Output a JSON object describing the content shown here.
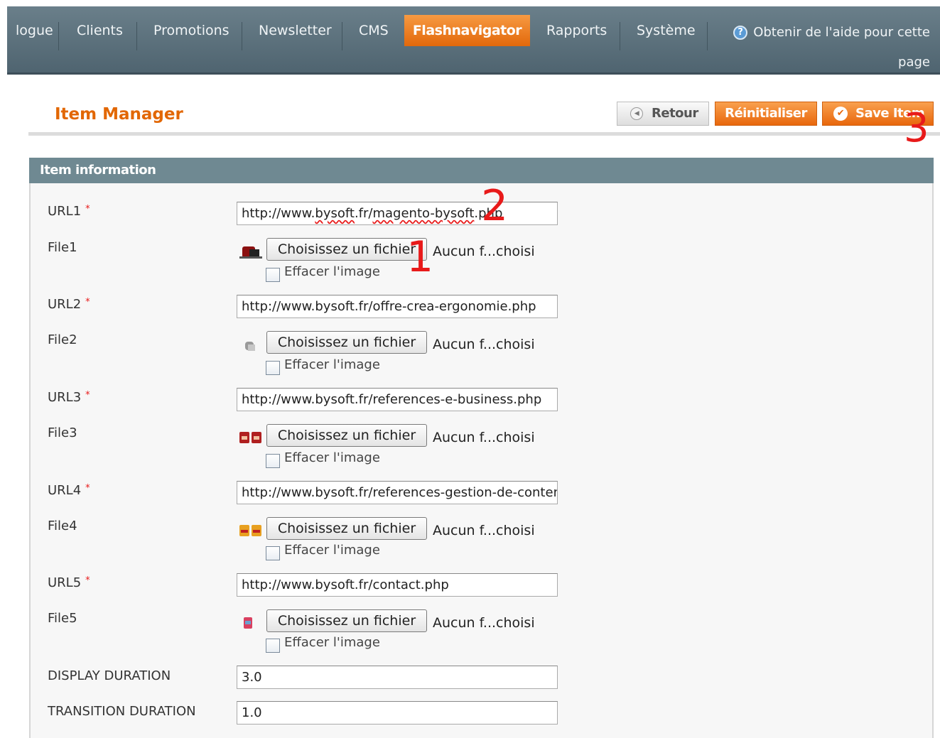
{
  "nav": {
    "items": [
      "logue",
      "Clients",
      "Promotions",
      "Newsletter",
      "CMS",
      "Flashnavigator",
      "Rapports",
      "Système"
    ],
    "help_text": "Obtenir de l'aide pour cette page"
  },
  "header": {
    "title": "Item Manager",
    "back_label": "Retour",
    "reset_label": "Réinitialiser",
    "save_label": "Save Item"
  },
  "annotations": [
    "1",
    "2",
    "3"
  ],
  "form": {
    "section_title": "Item information",
    "url1": {
      "label": "URL1",
      "required": "*",
      "value_plain": "http://www.",
      "value_under1": "bysoft",
      "value_mid": ".fr/",
      "value_under2": "magento-bysoft",
      "value_end": ".php"
    },
    "file1": {
      "label": "File1",
      "button": "Choisissez un fichier",
      "status": "Aucun f...choisi",
      "delete_label": "Effacer l'image"
    },
    "url2": {
      "label": "URL2",
      "required": "*",
      "value": "http://www.bysoft.fr/offre-crea-ergonomie.php"
    },
    "file2": {
      "label": "File2",
      "button": "Choisissez un fichier",
      "status": "Aucun f...choisi",
      "delete_label": "Effacer l'image"
    },
    "url3": {
      "label": "URL3",
      "required": "*",
      "value": "http://www.bysoft.fr/references-e-business.php"
    },
    "file3": {
      "label": "File3",
      "button": "Choisissez un fichier",
      "status": "Aucun f...choisi",
      "delete_label": "Effacer l'image"
    },
    "url4": {
      "label": "URL4",
      "required": "*",
      "value": "http://www.bysoft.fr/references-gestion-de-contenu"
    },
    "file4": {
      "label": "File4",
      "button": "Choisissez un fichier",
      "status": "Aucun f...choisi",
      "delete_label": "Effacer l'image"
    },
    "url5": {
      "label": "URL5",
      "required": "*",
      "value": "http://www.bysoft.fr/contact.php"
    },
    "file5": {
      "label": "File5",
      "button": "Choisissez un fichier",
      "status": "Aucun f...choisi",
      "delete_label": "Effacer l'image"
    },
    "display_duration": {
      "label": "DISPLAY DURATION",
      "value": "3.0"
    },
    "transition_duration": {
      "label": "TRANSITION DURATION",
      "value": "1.0"
    }
  },
  "colors": {
    "accent": "#e8670c",
    "nav": "#5b6f7a",
    "section_head": "#6f8992",
    "annotation": "#e81a1a"
  }
}
